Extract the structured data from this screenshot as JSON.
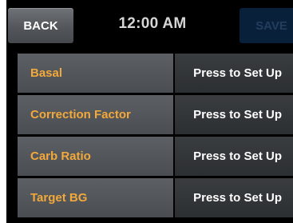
{
  "header": {
    "back_label": "BACK",
    "time": "12:00 AM",
    "save_label": "SAVE"
  },
  "settings": [
    {
      "label": "Basal",
      "value": "Press to Set Up"
    },
    {
      "label": "Correction Factor",
      "value": "Press to Set Up"
    },
    {
      "label": "Carb Ratio",
      "value": "Press to Set Up"
    },
    {
      "label": "Target BG",
      "value": "Press to Set Up"
    }
  ],
  "colors": {
    "label_text": "#f2a83a",
    "value_text": "#ffffff",
    "save_disabled": "#08203a",
    "background": "#000000"
  }
}
